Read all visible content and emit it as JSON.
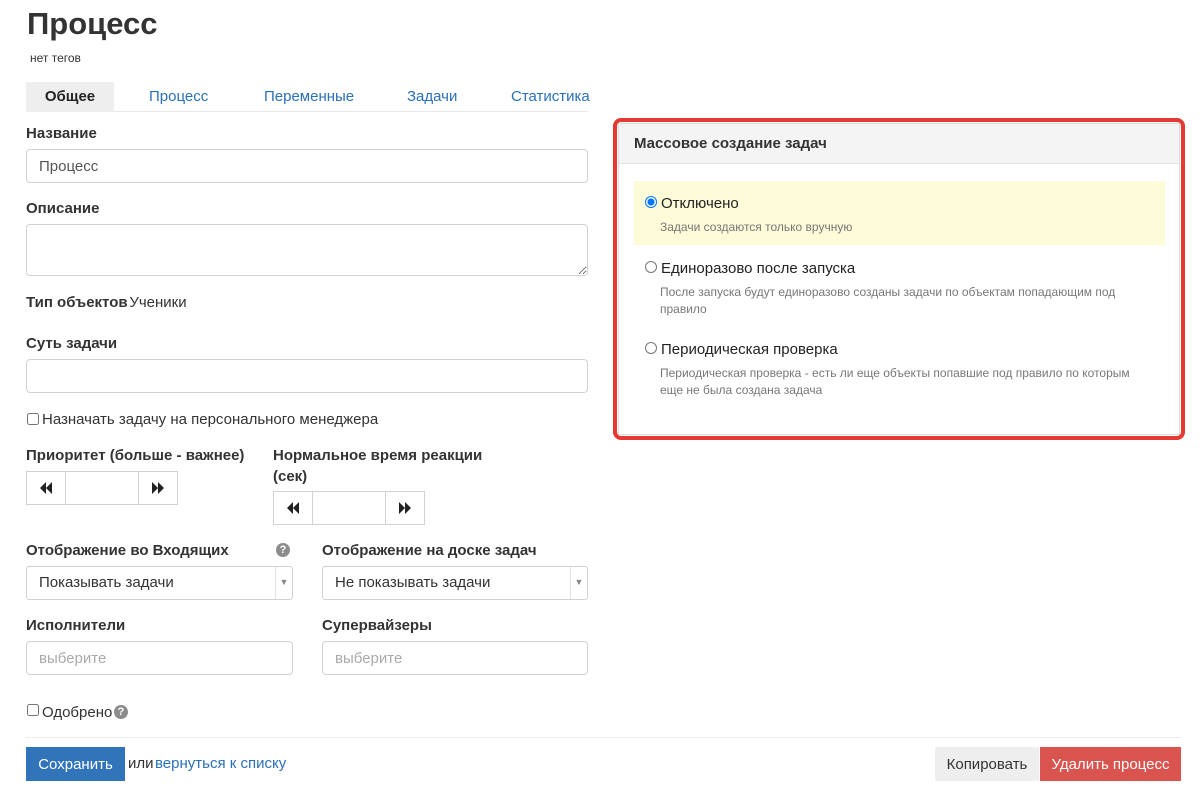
{
  "page": {
    "title": "Процесс",
    "tags": "нет тегов"
  },
  "tabs": [
    {
      "label": "Общее"
    },
    {
      "label": "Процесс"
    },
    {
      "label": "Переменные"
    },
    {
      "label": "Задачи"
    },
    {
      "label": "Статистика"
    }
  ],
  "form": {
    "name_label": "Название",
    "name_value": "Процесс",
    "description_label": "Описание",
    "description_value": "",
    "object_type_label": "Тип объектов",
    "object_type_value": ": Ученики",
    "task_essence_label": "Суть задачи",
    "task_essence_value": "",
    "assign_manager_label": "Назначать задачу на персонального менеджера",
    "priority_label": "Приоритет (больше - важнее)",
    "reaction_time_label_1": "Нормальное время реакции",
    "reaction_time_label_2": "(сек)",
    "inbox_display_label": "Отображение во Входящих",
    "inbox_display_value": "Показывать задачи",
    "board_display_label": "Отображение на доске задач",
    "board_display_value": "Не показывать задачи",
    "executors_label": "Исполнители",
    "executors_placeholder": "выберите",
    "supervisors_label": "Супервайзеры",
    "supervisors_placeholder": "выберите",
    "approved_label": "Одобрено"
  },
  "actions": {
    "save_label": "Сохранить",
    "or_text": "или",
    "back_link": "вернуться к списку",
    "copy_label": "Копировать",
    "delete_label": "Удалить процесс"
  },
  "mass_creation": {
    "title": "Массовое создание задач",
    "selected_index": 0,
    "options": [
      {
        "title": "Отключено",
        "description": "Задачи создаются только вручную"
      },
      {
        "title": "Единоразово после запуска",
        "description": "После запуска будут единоразово созданы задачи по объектам попадающим под правило"
      },
      {
        "title": "Периодическая проверка",
        "description": "Периодическая проверка - есть ли еще объекты попавшие под правило по которым еще не была создана задача"
      }
    ]
  },
  "colors": {
    "accent": "#3174b9",
    "link": "#2a70b8",
    "danger": "#d9534f",
    "highlight_border": "#e53a32",
    "selected_option_bg": "#fdfbd8"
  },
  "icons": {
    "help": "question-circle-icon",
    "rewind": "rewind-icon",
    "forward": "fast-forward-icon",
    "dropdown": "caret-down-icon"
  }
}
